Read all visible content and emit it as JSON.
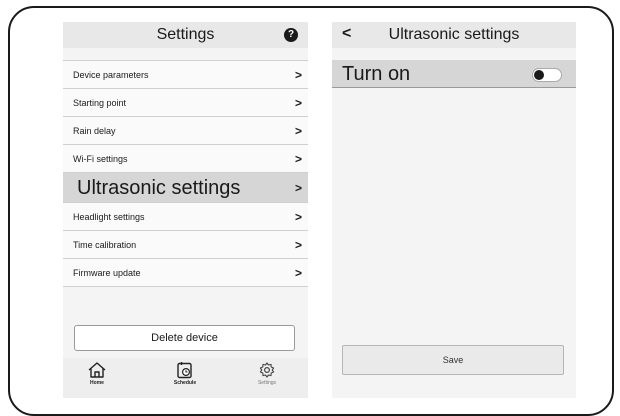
{
  "settings": {
    "title": "Settings",
    "help_icon_glyph": "?",
    "items": [
      {
        "label": "Device parameters",
        "chevron": ">"
      },
      {
        "label": "Starting point",
        "chevron": ">"
      },
      {
        "label": "Rain delay",
        "chevron": ">"
      },
      {
        "label": "Wi-Fi settings",
        "chevron": ">"
      },
      {
        "label": "Ultrasonic settings",
        "chevron": ">",
        "selected": true
      },
      {
        "label": "Headlight settings",
        "chevron": ">"
      },
      {
        "label": "Time calibration",
        "chevron": ">"
      },
      {
        "label": "Firmware update",
        "chevron": ">"
      }
    ],
    "delete_label": "Delete device",
    "tabs": [
      {
        "label": "Home",
        "icon": "home-icon"
      },
      {
        "label": "Schedule",
        "icon": "calendar-clock-icon"
      },
      {
        "label": "Settings",
        "icon": "gear-icon"
      }
    ]
  },
  "ultrasonic": {
    "back_glyph": "<",
    "title": "Ultrasonic settings",
    "toggle_label": "Turn on",
    "toggle_on": false,
    "save_label": "Save"
  }
}
